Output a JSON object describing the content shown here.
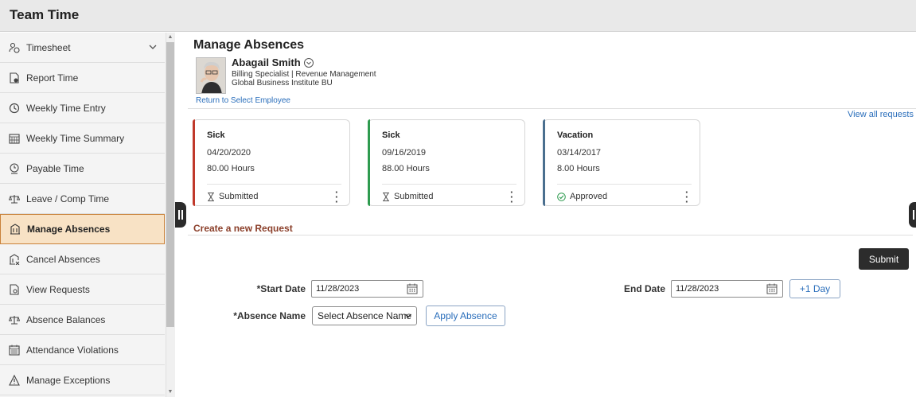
{
  "app": {
    "title": "Team Time"
  },
  "sidebar": {
    "items": [
      {
        "label": "Timesheet",
        "icon": "person-clock-icon",
        "has_chevron": true
      },
      {
        "label": "Report Time",
        "icon": "report-time-icon"
      },
      {
        "label": "Weekly Time Entry",
        "icon": "clock-icon"
      },
      {
        "label": "Weekly Time Summary",
        "icon": "calendar-grid-icon"
      },
      {
        "label": "Payable Time",
        "icon": "payable-time-icon"
      },
      {
        "label": "Leave / Comp Time",
        "icon": "scale-icon"
      },
      {
        "label": "Manage Absences",
        "icon": "building-icon",
        "active": true
      },
      {
        "label": "Cancel Absences",
        "icon": "building-cancel-icon"
      },
      {
        "label": "View Requests",
        "icon": "document-icon"
      },
      {
        "label": "Absence Balances",
        "icon": "scale-icon"
      },
      {
        "label": "Attendance Violations",
        "icon": "calendar-icon"
      },
      {
        "label": "Manage Exceptions",
        "icon": "warning-icon"
      }
    ]
  },
  "page": {
    "title": "Manage Absences"
  },
  "employee": {
    "name": "Abagail Smith",
    "line1": "Billing Specialist | Revenue Management",
    "line2": "Global Business Institute BU",
    "return_link": "Return to Select Employee"
  },
  "view_all_label": "View all requests",
  "colors": {
    "red": "#c0392b",
    "green": "#2e9b4f",
    "blue": "#4a6f8f",
    "active_bg": "#f8e2c5",
    "link": "#2a6ebb"
  },
  "cards": [
    {
      "type": "Sick",
      "date": "04/20/2020",
      "hours": "80.00 Hours",
      "status": "Submitted",
      "status_icon": "hourglass-icon"
    },
    {
      "type": "Sick",
      "date": "09/16/2019",
      "hours": "88.00 Hours",
      "status": "Submitted",
      "status_icon": "hourglass-icon"
    },
    {
      "type": "Vacation",
      "date": "03/14/2017",
      "hours": "8.00 Hours",
      "status": "Approved",
      "status_icon": "check-circle-icon"
    }
  ],
  "new_request": {
    "title": "Create a new Request",
    "submit_label": "Submit",
    "start_date_label": "*Start Date",
    "start_date_value": "11/28/2023",
    "end_date_label": "End Date",
    "end_date_value": "11/28/2023",
    "plus_day_label": "+1 Day",
    "absence_name_label": "*Absence Name",
    "absence_name_selected": "Select Absence Name",
    "apply_label": "Apply Absence"
  }
}
